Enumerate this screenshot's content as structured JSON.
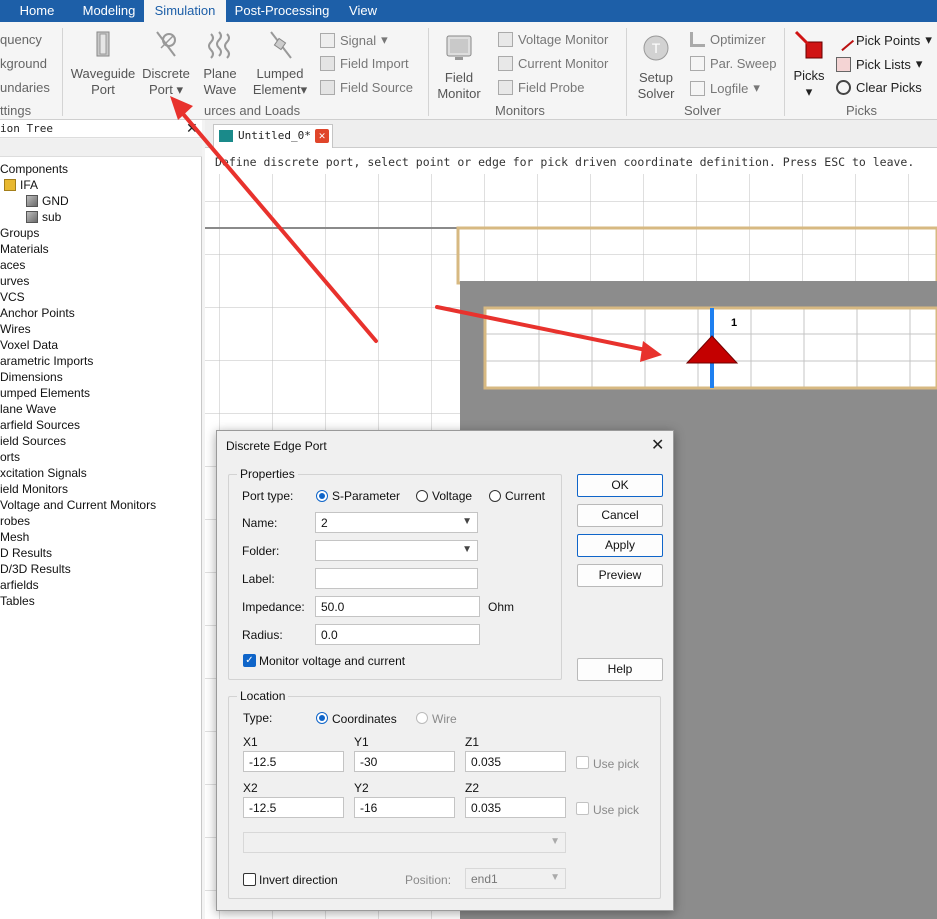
{
  "ribbon_tabs": [
    "Home",
    "Modeling",
    "Simulation",
    "Post-Processing",
    "View"
  ],
  "active_tab": "Simulation",
  "ribbon": {
    "left_clipped": [
      "quency",
      "kground",
      "undaries",
      "ttings"
    ],
    "sources_group": {
      "label": "urces and Loads",
      "buttons": [
        {
          "line1": "Waveguide",
          "line2": "Port"
        },
        {
          "line1": "Discrete",
          "line2": "Port",
          "dropdown": "▾"
        },
        {
          "line1": "Plane",
          "line2": "Wave"
        },
        {
          "line1": "Lumped",
          "line2": "Element",
          "dropdown": "▾"
        }
      ],
      "small": [
        {
          "label": "Signal",
          "dropdown": "▾"
        },
        {
          "label": "Field Import"
        },
        {
          "label": "Field Source"
        }
      ]
    },
    "monitors_group": {
      "label": "Monitors",
      "button": {
        "line1": "Field",
        "line2": "Monitor"
      },
      "small": [
        "Voltage Monitor",
        "Current Monitor",
        "Field Probe"
      ]
    },
    "solver_group": {
      "label": "Solver",
      "button": {
        "line1": "Setup",
        "line2": "Solver"
      },
      "small": [
        {
          "label": "Optimizer"
        },
        {
          "label": "Par. Sweep"
        },
        {
          "label": "Logfile",
          "dropdown": "▾"
        }
      ]
    },
    "picks_group": {
      "label": "Picks",
      "button": {
        "line1": "Picks",
        "dropdown": "▾"
      },
      "small": [
        {
          "label": "Pick Points",
          "dropdown": "▾"
        },
        {
          "label": "Pick Lists",
          "dropdown": "▾"
        },
        {
          "label": "Clear Picks"
        }
      ]
    }
  },
  "nav_tree": {
    "title": "ion Tree",
    "close": "✕",
    "items": [
      "Components",
      "IFA",
      "GND",
      "sub",
      "Groups",
      "Materials",
      "aces",
      "urves",
      "VCS",
      "Anchor Points",
      "Wires",
      "Voxel Data",
      "arametric Imports",
      "Dimensions",
      "umped Elements",
      "lane Wave",
      "arfield Sources",
      "ield Sources",
      "orts",
      "xcitation Signals",
      "ield Monitors",
      "Voltage and Current Monitors",
      "robes",
      "Mesh",
      "D Results",
      "D/3D Results",
      "arfields",
      "Tables"
    ]
  },
  "doc_tab": {
    "title": "Untitled_0*",
    "close": "✕"
  },
  "status_hint": "Define discrete port, select point or edge for pick driven coordinate definition. Press ESC to leave.",
  "port_number_label": "1",
  "colors": {
    "ribbon_tab_bar": "#1d5fa8",
    "annotation_arrow": "#e8322d",
    "port_marker": "#c40000",
    "port_edge": "#1e7ff0",
    "substrate": "#8c8c8c",
    "outline": "#d7b982"
  },
  "dialog": {
    "title": "Discrete Edge Port",
    "close": "✕",
    "properties_title": "Properties",
    "port_type_label": "Port type:",
    "port_type_options": [
      "S-Parameter",
      "Voltage",
      "Current"
    ],
    "port_type_selected": "S-Parameter",
    "name_label": "Name:",
    "name_value": "2",
    "folder_label": "Folder:",
    "folder_value": "",
    "label_label": "Label:",
    "label_value": "",
    "impedance_label": "Impedance:",
    "impedance_value": "50.0",
    "impedance_unit": "Ohm",
    "radius_label": "Radius:",
    "radius_value": "0.0",
    "monitor_label": "Monitor voltage and current",
    "monitor_checked": true,
    "location_title": "Location",
    "type_label": "Type:",
    "type_options": [
      "Coordinates",
      "Wire"
    ],
    "type_selected": "Coordinates",
    "x1_label": "X1",
    "x1_value": "-12.5",
    "y1_label": "Y1",
    "y1_value": "-30",
    "z1_label": "Z1",
    "z1_value": "0.035",
    "x2_label": "X2",
    "x2_value": "-12.5",
    "y2_label": "Y2",
    "y2_value": "-16",
    "z2_label": "Z2",
    "z2_value": "0.035",
    "use_pick_label": "Use pick",
    "invert_label": "Invert direction",
    "invert_checked": false,
    "position_label": "Position:",
    "position_value": "end1",
    "buttons": {
      "ok": "OK",
      "cancel": "Cancel",
      "apply": "Apply",
      "preview": "Preview",
      "help": "Help"
    }
  }
}
